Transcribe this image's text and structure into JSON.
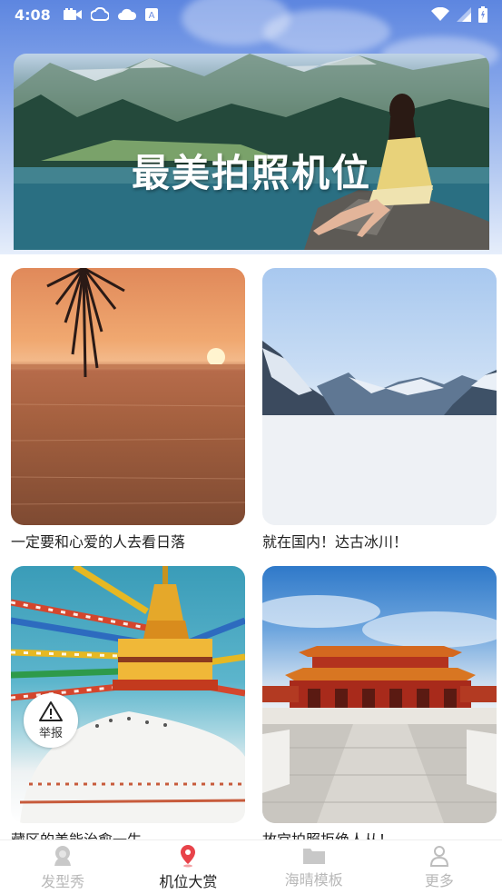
{
  "status_bar": {
    "time": "4:08"
  },
  "banner": {
    "title": "最美拍照机位"
  },
  "cards": [
    {
      "caption": "一定要和心爱的人去看日落"
    },
    {
      "caption": "就在国内！达古冰川！"
    },
    {
      "caption": "藏区的美能治愈一生"
    },
    {
      "caption": "故宫拍照拒绝人从！"
    }
  ],
  "report": {
    "label": "举报",
    "icon": "warning-icon"
  },
  "bottom_nav": {
    "items": [
      {
        "label": "发型秀",
        "icon": "hairstyle-icon",
        "active": false
      },
      {
        "label": "机位大赏",
        "icon": "location-pin-icon",
        "active": true
      },
      {
        "label": "海晴模板",
        "icon": "folder-icon",
        "active": false
      },
      {
        "label": "更多",
        "icon": "person-icon",
        "active": false
      }
    ]
  },
  "colors": {
    "active_icon": "#e8434a",
    "inactive": "#b8b8b8",
    "active_text": "#222222"
  }
}
